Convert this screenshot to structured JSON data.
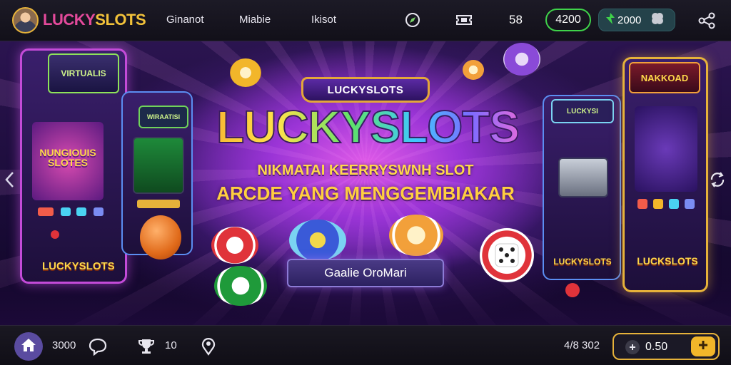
{
  "colors": {
    "accent_gold": "#e6b23a",
    "balance_green": "#3fd34a",
    "brand_pink": "#e54a9c",
    "brand_yellow": "#f2c23a"
  },
  "topbar": {
    "avatar_icon": "user-avatar",
    "brand_part1": "LUCKY",
    "brand_part2": "SLOTS",
    "nav": [
      "Ginanot",
      "Miabie",
      "Ikisot"
    ],
    "icons": [
      "compass-icon",
      "ticket-icon"
    ],
    "count": "58",
    "balance": "4200",
    "gems": "2000",
    "gem_icon": "gem-icon",
    "clover_icon": "clover-icon",
    "share_icon": "share-icon"
  },
  "hero": {
    "badge": "LUCKYSLOTS",
    "title": "LUCKYSLOTS",
    "subtitle1": "NIKMATAI KEERRYSWNH SLOT",
    "subtitle2": "ARCDE YANG MENGGEMBIAKAR",
    "cta": "Gaalie OroMari",
    "prev_icon": "chevron-left-icon",
    "refresh_icon": "refresh-icon",
    "cabinets": {
      "left_outer_top": "VIRTUALIS",
      "left_outer_screen": "NUNGIOUIS SLOTES",
      "left_outer_bottom": "LUCKYSLOTS",
      "left_inner_top": "WIRAATISI",
      "right_inner_top": "LUCKYSI",
      "right_inner_bottom": "LUCKYSLOTS",
      "right_outer_top": "NAKKOAD",
      "right_outer_bottom": "LUCKSLOTS"
    }
  },
  "bottombar": {
    "home_icon": "home-icon",
    "value1": "3000",
    "chat_icon": "chat-icon",
    "trophy_icon": "trophy-icon",
    "value2": "10",
    "pin_icon": "location-pin-icon",
    "right_value": "4/8 302",
    "coin_amount": "0.50",
    "minus_icon": "minus-icon",
    "plus_icon": "plus-icon"
  }
}
